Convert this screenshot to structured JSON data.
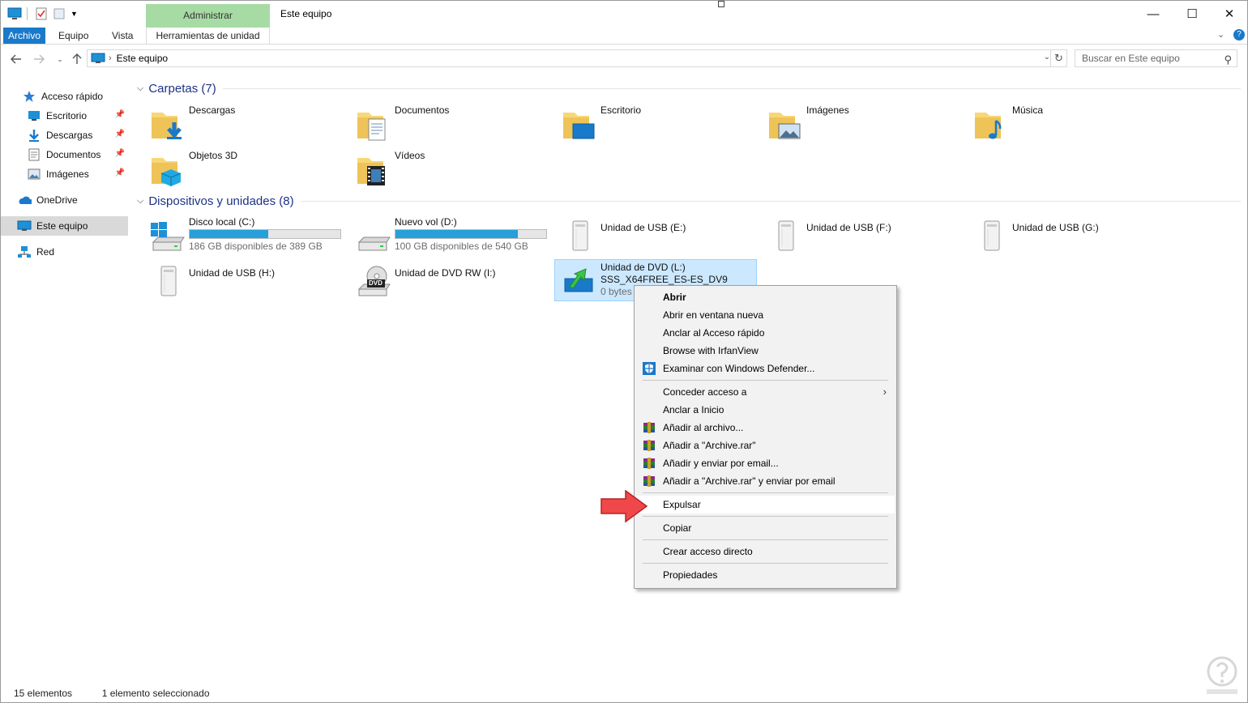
{
  "window": {
    "title": "Este equipo",
    "contextual_group": "Administrar",
    "controls": {
      "minimize": "—",
      "maximize": "☐",
      "close": "✕"
    }
  },
  "ribbon": {
    "tabs": [
      {
        "label": "Archivo"
      },
      {
        "label": "Equipo"
      },
      {
        "label": "Vista"
      },
      {
        "label": "Herramientas de unidad"
      }
    ]
  },
  "address": {
    "breadcrumb": "Este equipo",
    "search_placeholder": "Buscar en Este equipo"
  },
  "nav": {
    "quick_access": "Acceso rápido",
    "quick_items": [
      {
        "label": "Escritorio",
        "icon": "desktop-icon"
      },
      {
        "label": "Descargas",
        "icon": "download-icon"
      },
      {
        "label": "Documentos",
        "icon": "document-icon"
      },
      {
        "label": "Imágenes",
        "icon": "pictures-icon"
      }
    ],
    "onedrive": "OneDrive",
    "this_pc": "Este equipo",
    "network": "Red"
  },
  "folders_group": "Carpetas (7)",
  "folders": [
    {
      "label": "Descargas",
      "icon": "downloads-folder-icon"
    },
    {
      "label": "Documentos",
      "icon": "documents-folder-icon"
    },
    {
      "label": "Escritorio",
      "icon": "desktop-folder-icon"
    },
    {
      "label": "Imágenes",
      "icon": "pictures-folder-icon"
    },
    {
      "label": "Música",
      "icon": "music-folder-icon"
    },
    {
      "label": "Objetos 3D",
      "icon": "3d-objects-folder-icon"
    },
    {
      "label": "Vídeos",
      "icon": "videos-folder-icon"
    }
  ],
  "drives_group": "Dispositivos y unidades (8)",
  "drives": [
    {
      "label": "Disco local (C:)",
      "free": "186 GB disponibles de 389 GB",
      "used_fraction": 0.52
    },
    {
      "label": "Nuevo vol (D:)",
      "free": "100 GB disponibles de 540 GB",
      "used_fraction": 0.81
    },
    {
      "label": "Unidad de USB (E:)"
    },
    {
      "label": "Unidad de USB (F:)"
    },
    {
      "label": "Unidad de USB (G:)"
    },
    {
      "label": "Unidad de USB (H:)"
    },
    {
      "label": "Unidad de DVD RW (I:)",
      "badge": "DVD"
    },
    {
      "label": "Unidad de DVD (L:)",
      "volume": "SSS_X64FREE_ES-ES_DV9",
      "size": "0 bytes"
    }
  ],
  "context_menu": {
    "items": [
      {
        "label": "Abrir"
      },
      {
        "label": "Abrir en ventana nueva"
      },
      {
        "label": "Anclar al Acceso rápido"
      },
      {
        "label": "Browse with IrfanView"
      },
      {
        "label": "Examinar con Windows Defender..."
      },
      {
        "label": "Conceder acceso a"
      },
      {
        "label": "Anclar a Inicio"
      },
      {
        "label": "Añadir al archivo..."
      },
      {
        "label": "Añadir a \"Archive.rar\""
      },
      {
        "label": "Añadir y enviar por email..."
      },
      {
        "label": "Añadir a \"Archive.rar\" y enviar por email"
      },
      {
        "label": "Expulsar"
      },
      {
        "label": "Copiar"
      },
      {
        "label": "Crear acceso directo"
      },
      {
        "label": "Propiedades"
      }
    ]
  },
  "status": {
    "count": "15 elementos",
    "selection": "1 elemento seleccionado"
  },
  "colors": {
    "accent": "#1979ca",
    "selection_bg": "#cce8ff",
    "progress": "#26a0da",
    "group_header": "#1e3287",
    "contextual_tab": "#a7dba4"
  }
}
